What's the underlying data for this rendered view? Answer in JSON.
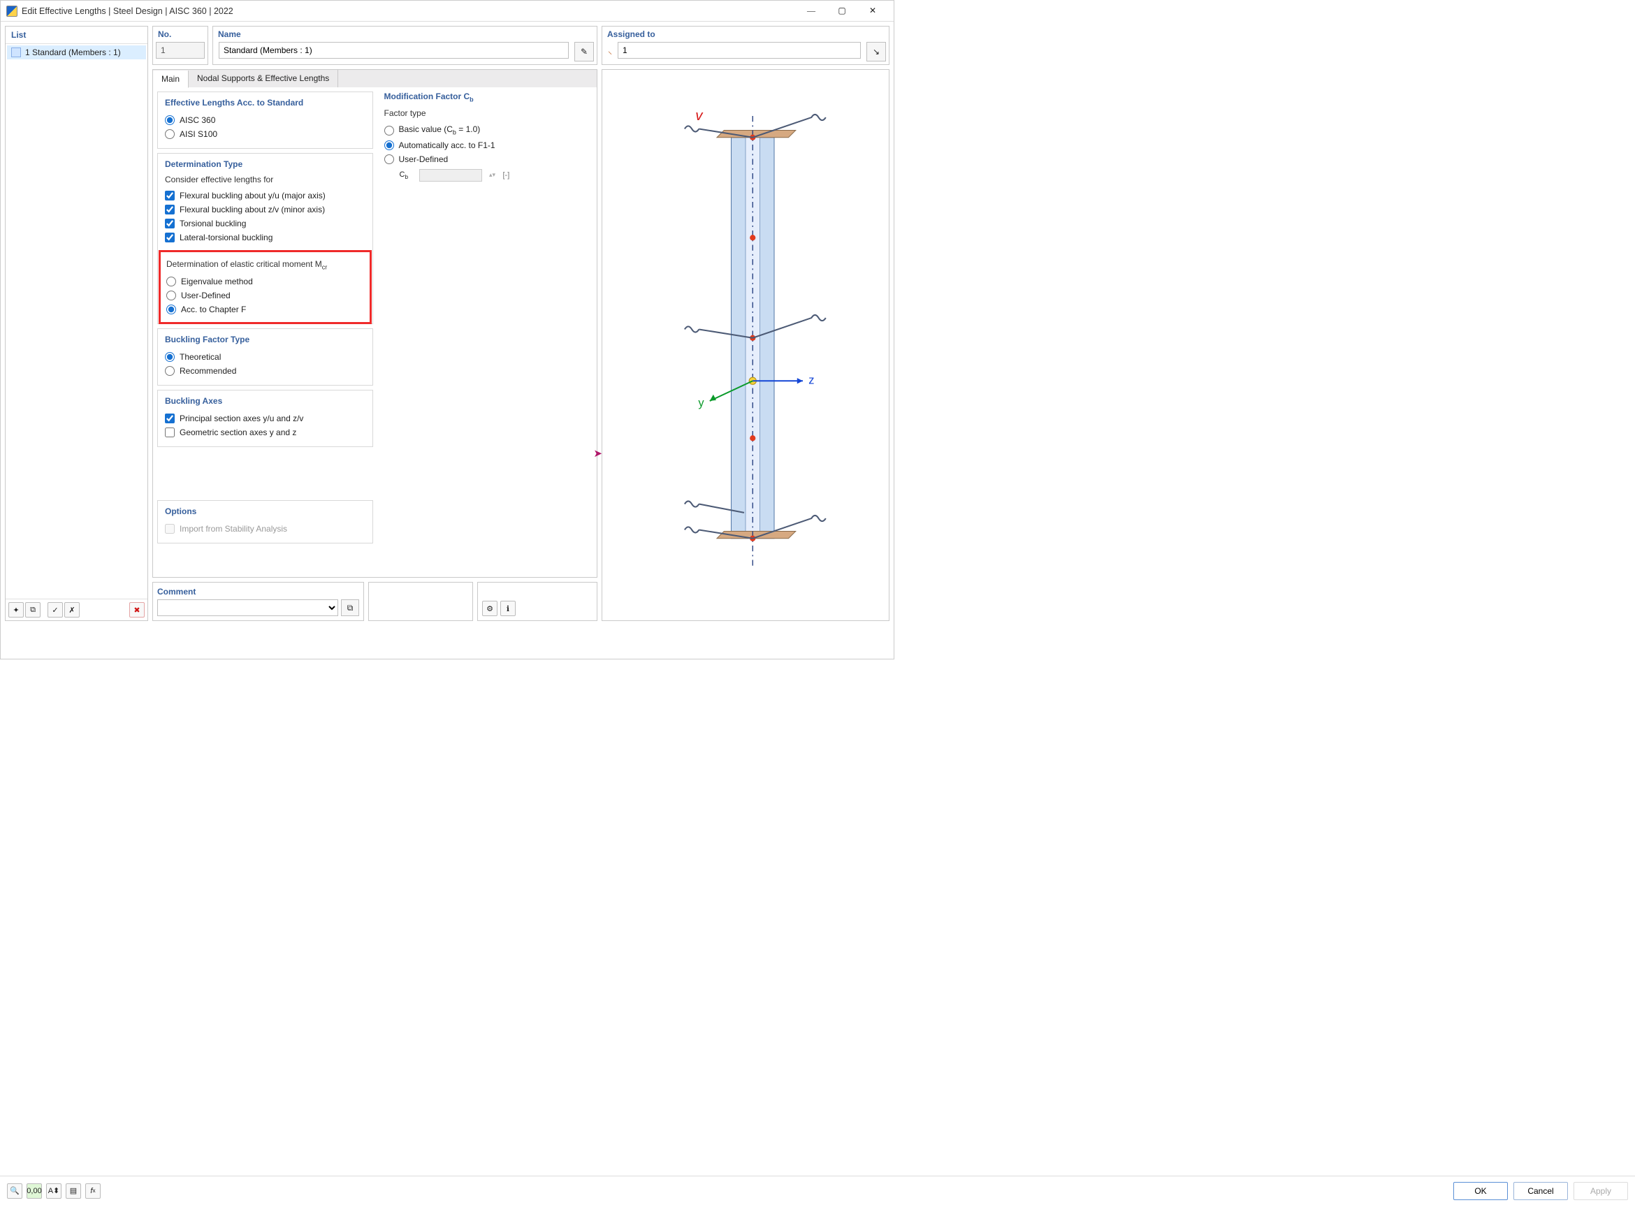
{
  "window": {
    "title": "Edit Effective Lengths | Steel Design | AISC 360 | 2022"
  },
  "list": {
    "header": "List",
    "items": [
      {
        "label": "1 Standard (Members : 1)",
        "selected": true
      }
    ]
  },
  "fields": {
    "no": {
      "label": "No.",
      "value": "1"
    },
    "name": {
      "label": "Name",
      "value": "Standard (Members : 1)"
    },
    "assigned": {
      "label": "Assigned to",
      "value": "1"
    }
  },
  "tabs": [
    {
      "label": "Main",
      "active": true
    },
    {
      "label": "Nodal Supports & Effective Lengths",
      "active": false
    }
  ],
  "eff": {
    "title": "Effective Lengths Acc. to Standard",
    "options": [
      {
        "label": "AISC 360",
        "checked": true
      },
      {
        "label": "AISI S100",
        "checked": false
      }
    ]
  },
  "det": {
    "title": "Determination Type",
    "subhead": "Consider effective lengths for",
    "checks": [
      {
        "label": "Flexural buckling about y/u (major axis)",
        "checked": true
      },
      {
        "label": "Flexural buckling about z/v (minor axis)",
        "checked": true
      },
      {
        "label": "Torsional buckling",
        "checked": true
      },
      {
        "label": "Lateral-torsional buckling",
        "checked": true
      }
    ],
    "mcr_label": "Determination of elastic critical moment M",
    "mcr_sub": "cr",
    "mcr_opts": [
      {
        "label": "Eigenvalue method",
        "checked": false
      },
      {
        "label": "User-Defined",
        "checked": false
      },
      {
        "label": "Acc. to Chapter F",
        "checked": true
      }
    ]
  },
  "bft": {
    "title": "Buckling Factor Type",
    "opts": [
      {
        "label": "Theoretical",
        "checked": true
      },
      {
        "label": "Recommended",
        "checked": false
      }
    ]
  },
  "axes": {
    "title": "Buckling Axes",
    "opts": [
      {
        "label": "Principal section axes y/u and z/v",
        "checked": true
      },
      {
        "label": "Geometric section axes y and z",
        "checked": false
      }
    ]
  },
  "options": {
    "title": "Options",
    "opts": [
      {
        "label": "Import from Stability Analysis",
        "checked": false,
        "disabled": true
      }
    ]
  },
  "cb": {
    "title": "Modification Factor C",
    "sub": "b",
    "ftlabel": "Factor type",
    "opts": [
      {
        "label": "Basic value (C_b = 1.0)",
        "display": "Basic value (C",
        "checked": false
      },
      {
        "label": "Automatically acc. to F1-1",
        "checked": true
      },
      {
        "label": "User-Defined",
        "checked": false
      }
    ],
    "field_label": "C",
    "field_sub": "b",
    "field_unit": "[-]"
  },
  "comment": {
    "title": "Comment",
    "value": ""
  },
  "buttons": {
    "ok": "OK",
    "cancel": "Cancel",
    "apply": "Apply"
  },
  "axis_labels": {
    "v": "v",
    "y": "y",
    "z": "z"
  }
}
